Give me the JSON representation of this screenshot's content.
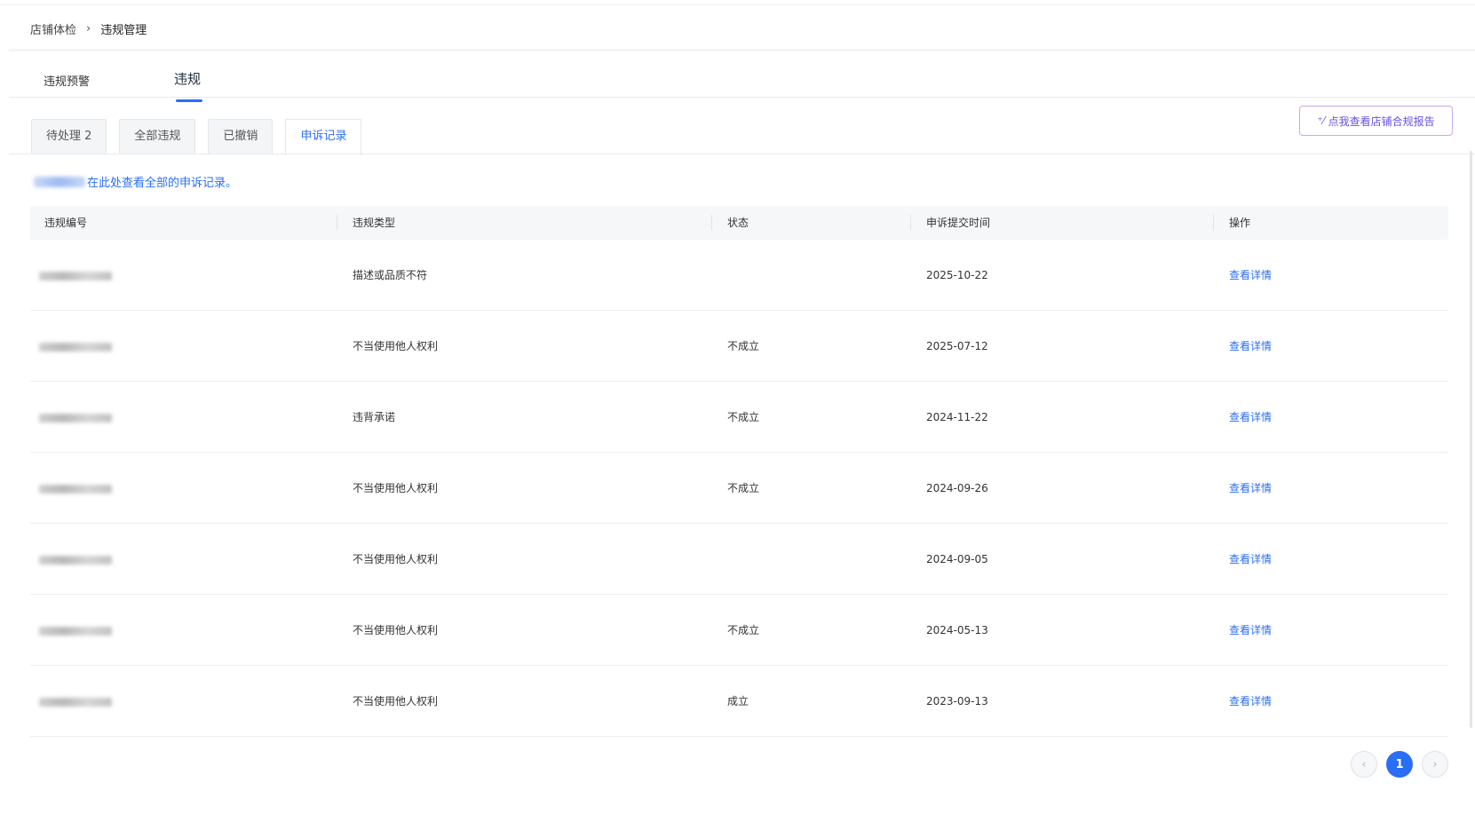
{
  "breadcrumb": {
    "parent": "店铺体检",
    "separator": "›",
    "current": "违规管理"
  },
  "main_tabs": [
    {
      "label": "违规预警",
      "active": false
    },
    {
      "label": "违规",
      "active": true
    }
  ],
  "sub_tabs": [
    {
      "label": "待处理 2",
      "active": false
    },
    {
      "label": "全部违规",
      "active": false
    },
    {
      "label": "已撤销",
      "active": false
    },
    {
      "label": "申诉记录",
      "active": true
    }
  ],
  "report_button": {
    "icon": "sparkle-icon",
    "label": "点我查看店铺合规报告"
  },
  "notice": {
    "text": "在此处查看全部的申诉记录。"
  },
  "table": {
    "columns": [
      "违规编号",
      "违规类型",
      "状态",
      "申诉提交时间",
      "操作"
    ],
    "rows": [
      {
        "type": "描述或品质不符",
        "status": "",
        "time": "2025-10-22",
        "action": "查看详情"
      },
      {
        "type": "不当使用他人权利",
        "status": "不成立",
        "time": "2025-07-12",
        "action": "查看详情"
      },
      {
        "type": "违背承诺",
        "status": "不成立",
        "time": "2024-11-22",
        "action": "查看详情"
      },
      {
        "type": "不当使用他人权利",
        "status": "不成立",
        "time": "2024-09-26",
        "action": "查看详情"
      },
      {
        "type": "不当使用他人权利",
        "status": "",
        "time": "2024-09-05",
        "action": "查看详情"
      },
      {
        "type": "不当使用他人权利",
        "status": "不成立",
        "time": "2024-05-13",
        "action": "查看详情"
      },
      {
        "type": "不当使用他人权利",
        "status": "成立",
        "time": "2023-09-13",
        "action": "查看详情"
      }
    ]
  },
  "pagination": {
    "prev": "‹",
    "current_page": "1",
    "next": "›"
  },
  "colors": {
    "accent": "#2b6ef5",
    "report_border": "#c9a7ef"
  }
}
